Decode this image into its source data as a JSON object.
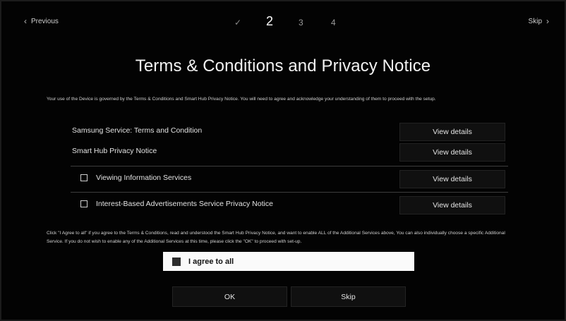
{
  "nav": {
    "previous_label": "Previous",
    "skip_label": "Skip",
    "previous_icon": "chevron-left-icon",
    "skip_icon": "chevron-right-icon",
    "steps": [
      {
        "label": "✓",
        "state": "done"
      },
      {
        "label": "2",
        "state": "current"
      },
      {
        "label": "3",
        "state": "upcoming"
      },
      {
        "label": "4",
        "state": "upcoming"
      }
    ]
  },
  "title": "Terms & Conditions and Privacy Notice",
  "intro_text": "Your use of the Device is governed by the Terms & Conditions and Smart Hub Privacy Notice. You will need to agree and acknowledge your understanding of them to proceed with the setup.",
  "agreements": [
    {
      "label": "Samsung Service: Terms and Condition",
      "button": "View details",
      "checkbox": false
    },
    {
      "label": "Smart Hub Privacy Notice",
      "button": "View details",
      "checkbox": false
    },
    {
      "label": "Viewing Information Services",
      "button": "View details",
      "checkbox": true,
      "checked": false
    },
    {
      "label": "Interest-Based Advertisements Service Privacy Notice",
      "button": "View details",
      "checkbox": true,
      "checked": false
    }
  ],
  "note_text": "Click \"I Agree to all\" if you agree to the Terms & Conditions, read and understood the Smart Hub Privacy Notice, and want to enable ALL of the Additional Services above, You can also individually choose a specific Additional Service. If you do not wish to enable any of the Additional Services at this time, please click the \"OK\" to proceed with set-up.",
  "agree_all": {
    "label": "I agree to all",
    "checked": false
  },
  "buttons": {
    "ok": "OK",
    "skip": "Skip"
  },
  "colors": {
    "background": "#030303",
    "text": "#e6e6e6",
    "highlight": "#fafafa"
  }
}
